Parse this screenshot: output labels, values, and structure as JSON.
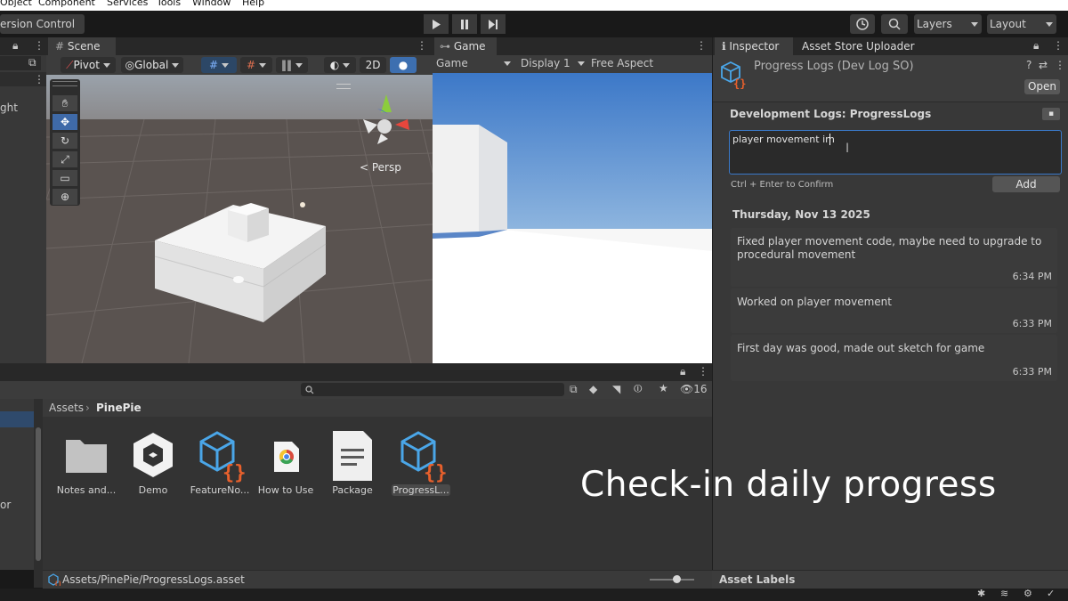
{
  "menubar": {
    "items": [
      "Object",
      "Component",
      "Services",
      "Tools",
      "Window",
      "Help"
    ]
  },
  "toolbar": {
    "version_control": "ersion Control",
    "layers": "Layers",
    "layout": "Layout"
  },
  "scene": {
    "tab": "Scene",
    "pivot": "Pivot",
    "global": "Global",
    "mode_2d": "2D",
    "persp": "< Persp",
    "left_partial_label": "ght"
  },
  "game": {
    "tab": "Game",
    "view_select": "Game",
    "display": "Display 1",
    "aspect": "Free Aspect"
  },
  "inspector": {
    "tab_inspector": "Inspector",
    "tab_uploader": "Asset Store Uploader",
    "asset_title": "Progress Logs (Dev Log SO)",
    "open_button": "Open",
    "section_title": "Development Logs: ProgressLogs",
    "input_value": "player movement im",
    "confirm_hint": "Ctrl + Enter to Confirm",
    "add_button": "Add",
    "date_header": "Thursday, Nov 13 2025",
    "entries": [
      {
        "text": "Fixed player movement code, maybe need to upgrade to procedural movement",
        "time": "6:34 PM"
      },
      {
        "text": "Worked on player movement",
        "time": "6:33 PM"
      },
      {
        "text": "First day was good, made out sketch for game",
        "time": "6:33 PM"
      }
    ],
    "asset_labels": "Asset Labels"
  },
  "project": {
    "breadcrumb_root": "Assets",
    "breadcrumb_folder": "PinePie",
    "hidden_count": "16",
    "left_partial_label": "or",
    "assets": [
      {
        "label": "Notes and...",
        "icon": "folder-icon"
      },
      {
        "label": "Demo",
        "icon": "unity-logo-icon"
      },
      {
        "label": "FeatureNo...",
        "icon": "scriptable-object-icon"
      },
      {
        "label": "How to Use",
        "icon": "chrome-icon"
      },
      {
        "label": "Package",
        "icon": "document-icon"
      },
      {
        "label": "ProgressL...",
        "icon": "scriptable-object-icon"
      }
    ],
    "status_path": "Assets/PinePie/ProgressLogs.asset"
  },
  "overlay_caption": "Check-in daily progress",
  "colors": {
    "accent_blue": "#3d7bd9",
    "input_border": "#3a79c9",
    "panel_bg": "#383838",
    "json_orange": "#e8602c",
    "cube_blue": "#3d9be0"
  }
}
